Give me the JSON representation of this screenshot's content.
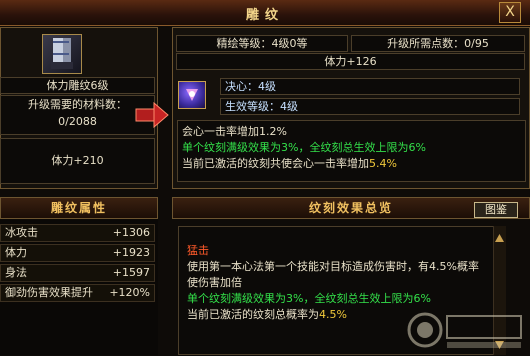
{
  "window": {
    "title": "雕纹",
    "close_label": "X"
  },
  "left": {
    "item_name": "体力雕纹6级",
    "req_label": "升级需要的材料数：",
    "req_value": "0/2088",
    "stat": "体力+210"
  },
  "right": {
    "rank": "精绘等级：4级0等",
    "need": "升级所需点数：0/95",
    "hp": "体力+126",
    "resolve": "决心：4级",
    "effect_level": "生效等级：4级",
    "line1": "会心一击率增加1.2%",
    "line2": "单个纹刻满级效果为3%，全纹刻总生效上限为6%",
    "line3_prefix": "当前已激活的纹刻共使会心一击率增加",
    "line3_value": "5.4%"
  },
  "attributes": {
    "header": "雕纹属性",
    "items": [
      {
        "label": "冰攻击",
        "value": "+1306"
      },
      {
        "label": "体力",
        "value": "+1923"
      },
      {
        "label": "身法",
        "value": "+1597"
      },
      {
        "label": "御劲伤害效果提升",
        "value": "+120%"
      }
    ]
  },
  "effects": {
    "header": "纹刻效果总览",
    "gallery_label": "图鉴",
    "title": "猛击",
    "body": "使用第一本心法第一个技能对目标造成伤害时，有4.5%概率使伤害加倍",
    "limit": "单个纹刻满级效果为3%，全纹刻总生效上限为6%",
    "current_prefix": "当前已激活的纹刻总概率为",
    "current_value": "4.5%"
  },
  "watermark": "神仙代售 WWW.SXDS.COM",
  "icons": {
    "item": "boots-icon",
    "gem": "pink-rune-icon",
    "arrow": "right-arrow-icon"
  },
  "colors": {
    "green": "#33e04a",
    "yellow": "#f0c83a",
    "header": "#f0c060",
    "title_red": "#ff5a2a"
  }
}
